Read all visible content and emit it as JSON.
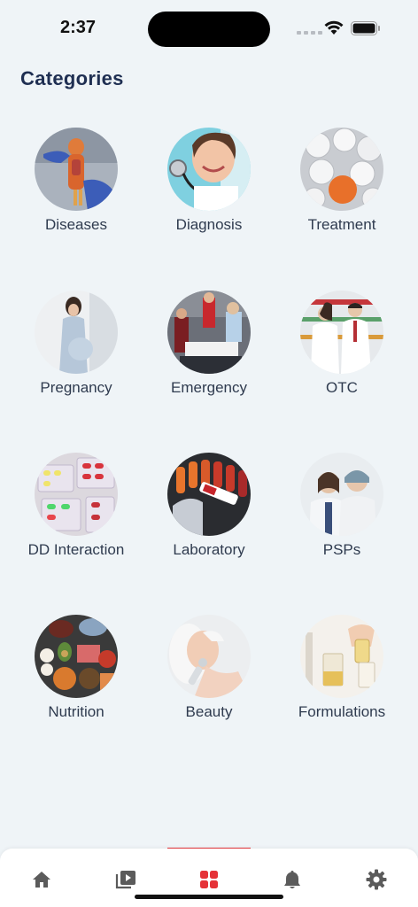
{
  "status": {
    "time": "2:37"
  },
  "page": {
    "title": "Categories"
  },
  "categories": [
    {
      "label": "Diseases"
    },
    {
      "label": "Diagnosis"
    },
    {
      "label": "Treatment"
    },
    {
      "label": "Pregnancy"
    },
    {
      "label": "Emergency"
    },
    {
      "label": "OTC"
    },
    {
      "label": "DD Interaction"
    },
    {
      "label": "Laboratory"
    },
    {
      "label": "PSPs"
    },
    {
      "label": "Nutrition"
    },
    {
      "label": "Beauty"
    },
    {
      "label": "Formulations"
    }
  ],
  "tabbar": {
    "tabs": [
      {
        "icon": "home-icon",
        "active": false
      },
      {
        "icon": "video-library-icon",
        "active": false
      },
      {
        "icon": "grid-icon",
        "active": true
      },
      {
        "icon": "bell-icon",
        "active": false
      },
      {
        "icon": "gear-icon",
        "active": false
      }
    ],
    "accent": "#e53238",
    "inactive_color": "#5b5b5b"
  }
}
